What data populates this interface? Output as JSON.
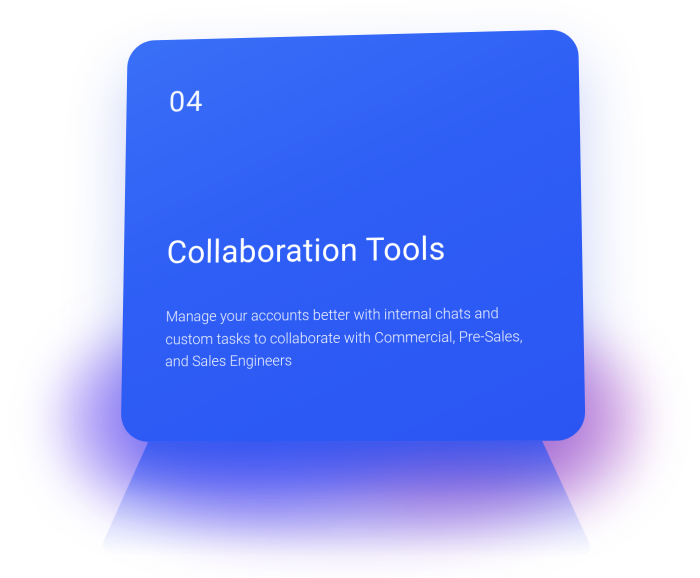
{
  "card": {
    "number": "04",
    "title": "Collaboration Tools",
    "description": "Manage your accounts better with internal chats and custom tasks to collaborate with Commercial, Pre-Sales, and Sales Engineers"
  }
}
